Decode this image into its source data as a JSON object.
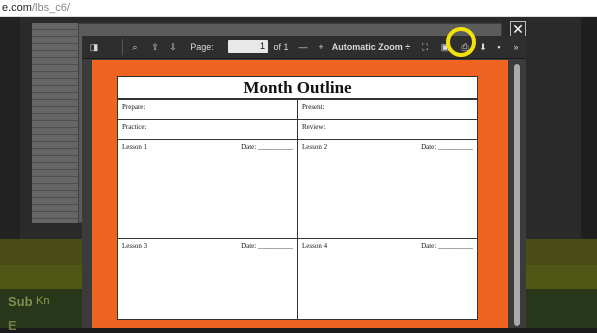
{
  "url": {
    "host": "e.com",
    "path": "/lbs_c6/"
  },
  "background": {
    "sub_label": "Sub",
    "sub_link": "Kn",
    "other_label": "E"
  },
  "close_button": "✕",
  "viewer": {
    "toolbar": {
      "sidebar_toggle": "◨",
      "search": "⌕",
      "prev": "⇧",
      "next": "⇩",
      "page_label": "Page:",
      "page_value": "1",
      "page_count": "of 1",
      "zoom_out": "—",
      "zoom_in": "+",
      "zoom_select": "Automatic Zoom ÷",
      "fullscreen": "⛶",
      "open_file": "▣",
      "print": "⎙",
      "download": "⬇",
      "bookmark": "▪",
      "more": "»"
    },
    "document": {
      "title": "Month Outline",
      "fields": {
        "prepare": "Prepare:",
        "present": "Present:",
        "practice": "Practice:",
        "review": "Review:"
      },
      "lessons": [
        {
          "label": "Lesson 1",
          "date": "Date: __________"
        },
        {
          "label": "Lesson 2",
          "date": "Date: __________"
        },
        {
          "label": "Lesson 3",
          "date": "Date: __________"
        },
        {
          "label": "Lesson 4",
          "date": "Date: __________"
        }
      ]
    }
  },
  "colors": {
    "page_bg": "#f06422",
    "highlight": "#f2e20c"
  }
}
